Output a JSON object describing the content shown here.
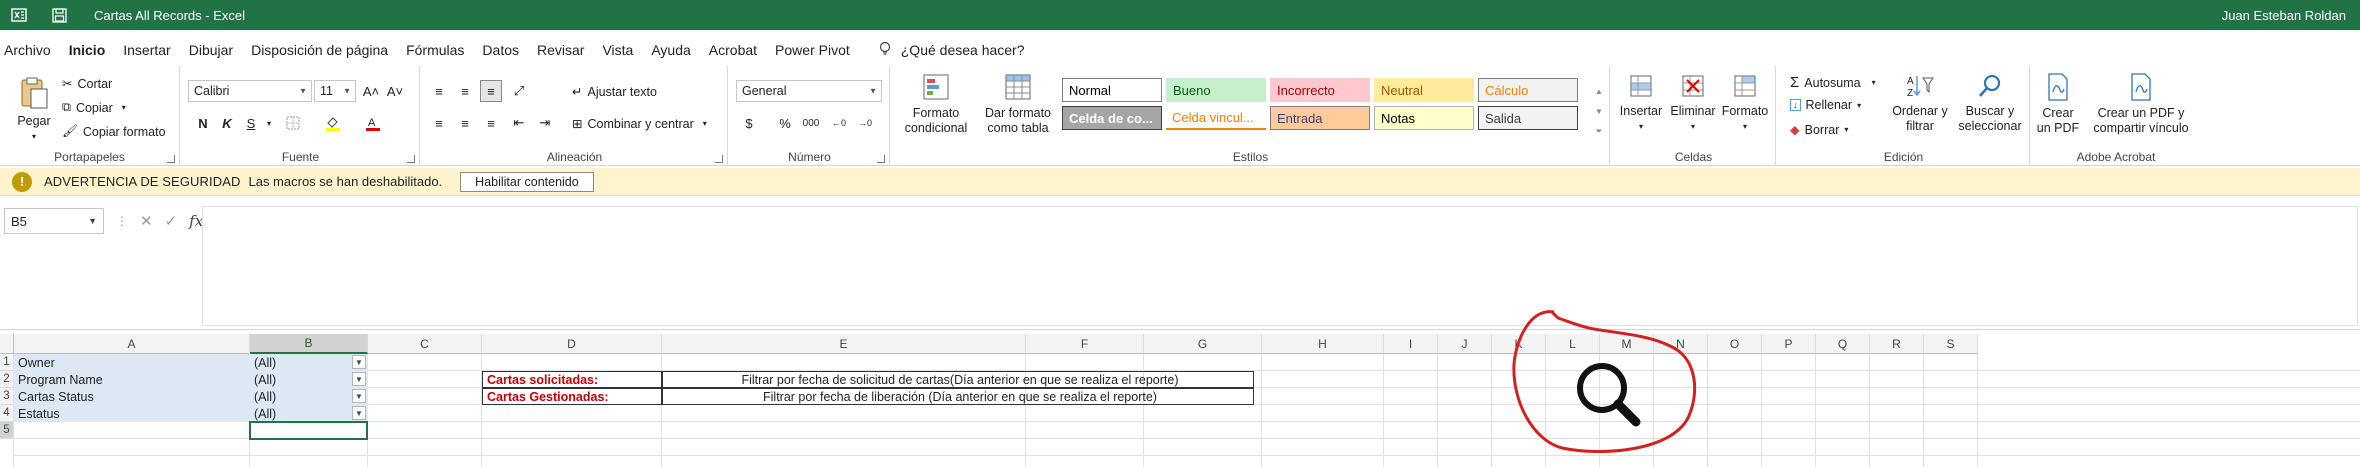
{
  "titlebar": {
    "title": "Cartas All Records  -  Excel",
    "user": "Juan Esteban Roldan"
  },
  "menu": {
    "items": [
      "Archivo",
      "Inicio",
      "Insertar",
      "Dibujar",
      "Disposición de página",
      "Fórmulas",
      "Datos",
      "Revisar",
      "Vista",
      "Ayuda",
      "Acrobat",
      "Power Pivot"
    ],
    "active": "Inicio",
    "tell_me": "¿Qué desea hacer?"
  },
  "ribbon": {
    "portapapeles": {
      "label": "Portapapeles",
      "paste": "Pegar",
      "cut": "Cortar",
      "copy": "Copiar",
      "format_painter": "Copiar formato"
    },
    "fuente": {
      "label": "Fuente",
      "font_name": "Calibri",
      "font_size": "11",
      "bold": "N",
      "italic": "K",
      "underline": "S",
      "grow": "A˄",
      "shrink": "A˅"
    },
    "alineacion": {
      "label": "Alineación",
      "wrap": "Ajustar texto",
      "merge": "Combinar y centrar"
    },
    "numero": {
      "label": "Número",
      "format": "General",
      "currency": "$",
      "percent": "%",
      "thousands": "000"
    },
    "estilos": {
      "label": "Estilos",
      "conditional": "Formato condicional",
      "table": "Dar formato como tabla",
      "styles": [
        {
          "name": "Normal",
          "bg": "#ffffff",
          "color": "#000000",
          "border": "#7f7f7f"
        },
        {
          "name": "Bueno",
          "bg": "#c6efce",
          "color": "#006100",
          "border": "#c6efce"
        },
        {
          "name": "Incorrecto",
          "bg": "#ffc7ce",
          "color": "#9c0006",
          "border": "#ffc7ce"
        },
        {
          "name": "Neutral",
          "bg": "#ffeb9c",
          "color": "#9c5700",
          "border": "#ffeb9c"
        },
        {
          "name": "Cálculo",
          "bg": "#f2f2f2",
          "color": "#fa7d00",
          "border": "#7f7f7f"
        },
        {
          "name": "Celda de co...",
          "bg": "#a5a5a5",
          "color": "#ffffff",
          "border": "#3f3f3f"
        },
        {
          "name": "Celda vincul...",
          "bg": "#ffffff",
          "color": "#fa7d00",
          "border": "#ff8001"
        },
        {
          "name": "Entrada",
          "bg": "#ffcc99",
          "color": "#3f3f76",
          "border": "#7f7f7f"
        },
        {
          "name": "Notas",
          "bg": "#ffffcc",
          "color": "#000000",
          "border": "#b2b2b2"
        },
        {
          "name": "Salida",
          "bg": "#f2f2f2",
          "color": "#3f3f3f",
          "border": "#3f3f3f"
        }
      ]
    },
    "celdas": {
      "label": "Celdas",
      "insert": "Insertar",
      "delete": "Eliminar",
      "format": "Formato"
    },
    "edicion": {
      "label": "Edición",
      "autosum": "Autosuma",
      "fill": "Rellenar",
      "clear": "Borrar",
      "sort": "Ordenar y filtrar",
      "find": "Buscar y seleccionar"
    },
    "acrobat": {
      "label": "Adobe Acrobat",
      "create_pdf": "Crear un PDF",
      "create_share": "Crear un PDF y compartir vínculo"
    }
  },
  "security": {
    "title": "ADVERTENCIA DE SEGURIDAD",
    "message": "Las macros se han deshabilitado.",
    "button": "Habilitar contenido"
  },
  "formula": {
    "namebox": "B5",
    "fx": "fx",
    "value": ""
  },
  "grid": {
    "columns": [
      "A",
      "B",
      "C",
      "D",
      "E",
      "F",
      "G",
      "H",
      "I",
      "J",
      "K",
      "L",
      "M",
      "N",
      "O",
      "P",
      "Q",
      "R",
      "S"
    ],
    "selected_column": "B",
    "rows": [
      "1",
      "2",
      "3",
      "4",
      "5"
    ],
    "selected_row": "5",
    "pivot_filters": [
      {
        "field": "Owner",
        "value": "(All)"
      },
      {
        "field": "Program Name",
        "value": "(All)"
      },
      {
        "field": "Cartas Status",
        "value": "(All)"
      },
      {
        "field": "Estatus",
        "value": "(All)"
      }
    ],
    "notes": [
      {
        "label": "Cartas solicitadas:",
        "text": "Filtrar por fecha de solicitud de cartas(Día anterior en que se realiza el reporte)"
      },
      {
        "label": "Cartas Gestionadas:",
        "text": "Filtrar por fecha de liberación (Día anterior en que se realiza el reporte)"
      }
    ]
  },
  "colors": {
    "excel_green": "#217346",
    "annotation_red": "#d42020",
    "security_bg": "#fff4ce",
    "pivot_bg": "#dce9f5"
  },
  "annotation": {
    "icon": "magnifier-icon"
  }
}
